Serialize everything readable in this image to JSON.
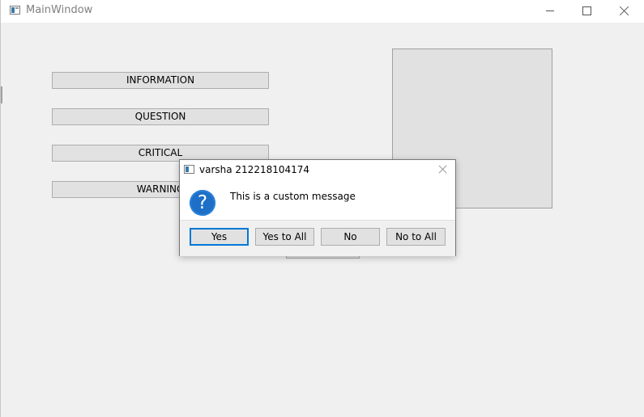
{
  "window": {
    "title": "MainWindow",
    "controls": {
      "minimize_icon": "minimize-icon",
      "maximize_icon": "maximize-icon",
      "close_icon": "close-icon"
    }
  },
  "main": {
    "buttons": {
      "information": "INFORMATION",
      "question": "QUESTION",
      "critical": "CRITICAL",
      "warning": "WARNING"
    }
  },
  "dialog": {
    "title": "varsha 212218104174",
    "message": "This is a custom message",
    "icon": "question-icon",
    "icon_glyph": "?",
    "buttons": {
      "yes": "Yes",
      "yes_to_all": "Yes to All",
      "no": "No",
      "no_to_all": "No to All"
    }
  },
  "colors": {
    "window_bg": "#f0f0f0",
    "button_bg": "#e1e1e1",
    "default_button_border": "#0078d7",
    "question_icon_bg": "#1d6fc7"
  }
}
